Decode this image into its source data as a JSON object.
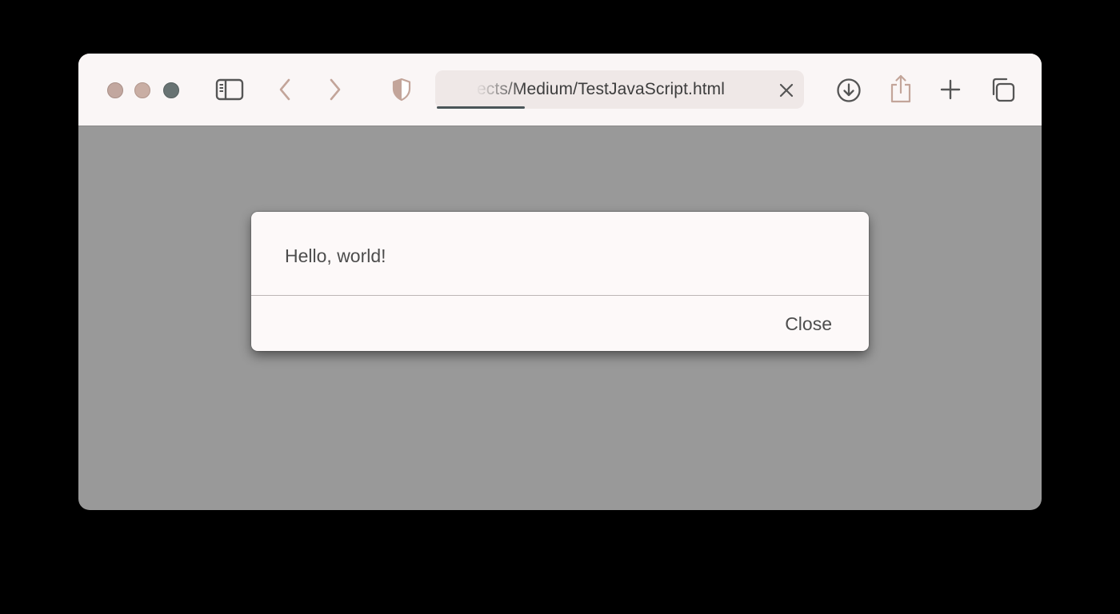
{
  "window": {
    "traffic_lights": [
      {
        "name": "close",
        "color": "#c2a79f"
      },
      {
        "name": "minimize",
        "color": "#c9aea4"
      },
      {
        "name": "zoom",
        "color": "#687373"
      }
    ]
  },
  "toolbar": {
    "icons": {
      "sidebar": "sidebar-icon",
      "back": "chevron-left-icon",
      "forward": "chevron-right-icon",
      "privacy": "shield-icon",
      "clear": "close-icon",
      "downloads": "download-icon",
      "share": "share-icon",
      "new_tab": "plus-icon",
      "tabs": "tab-overview-icon"
    },
    "url": "ects/Medium/TestJavaScript.html",
    "accent_color": "#c3a59a",
    "icon_color": "#555555"
  },
  "content": {
    "background_color": "#999999"
  },
  "dialog": {
    "message": "Hello, world!",
    "close_label": "Close"
  }
}
